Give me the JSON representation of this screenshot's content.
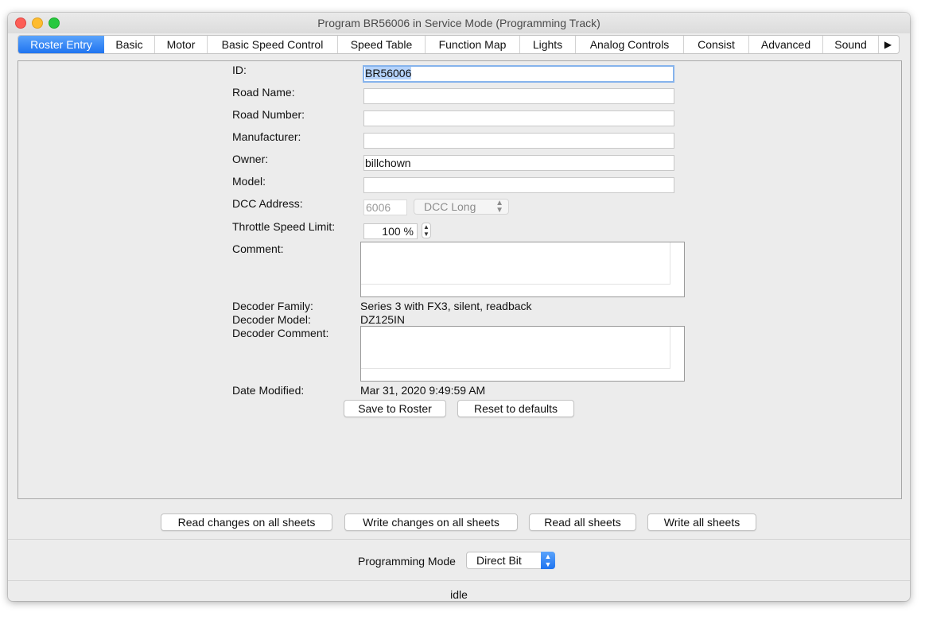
{
  "window": {
    "title": "Program BR56006 in Service Mode (Programming Track)"
  },
  "tabs": [
    {
      "label": "Roster Entry"
    },
    {
      "label": "Basic"
    },
    {
      "label": "Motor"
    },
    {
      "label": "Basic Speed Control"
    },
    {
      "label": "Speed Table"
    },
    {
      "label": "Function Map"
    },
    {
      "label": "Lights"
    },
    {
      "label": "Analog Controls"
    },
    {
      "label": "Consist"
    },
    {
      "label": "Advanced"
    },
    {
      "label": "Sound"
    },
    {
      "label": "▶"
    }
  ],
  "roster": {
    "id_label": "ID:",
    "id_value": "BR56006",
    "road_name_label": "Road Name:",
    "road_name_value": "",
    "road_number_label": "Road Number:",
    "road_number_value": "",
    "manufacturer_label": "Manufacturer:",
    "manufacturer_value": "",
    "owner_label": "Owner:",
    "owner_value": "billchown",
    "model_label": "Model:",
    "model_value": "",
    "dcc_address_label": "DCC Address:",
    "dcc_address_value": "6006",
    "dcc_type": "DCC Long",
    "throttle_label": "Throttle Speed Limit:",
    "throttle_value": "100 %",
    "comment_label": "Comment:",
    "decoder_family_label": "Decoder Family:",
    "decoder_family_value": "Series 3 with FX3, silent, readback",
    "decoder_model_label": "Decoder Model:",
    "decoder_model_value": "DZ125IN",
    "decoder_comment_label": "Decoder Comment:",
    "date_modified_label": "Date Modified:",
    "date_modified_value": "Mar 31, 2020 9:49:59 AM",
    "save_button": "Save to Roster",
    "reset_button": "Reset to defaults"
  },
  "bottom_buttons": {
    "read_changes": "Read changes on all sheets",
    "write_changes": "Write changes on all sheets",
    "read_all": "Read all sheets",
    "write_all": "Write all sheets"
  },
  "programming_mode": {
    "label": "Programming Mode",
    "value": "Direct Bit"
  },
  "status": "idle",
  "colors": {
    "accent": "#1f74f0",
    "selection": "#b5d3fb",
    "window_bg": "#ececec"
  }
}
